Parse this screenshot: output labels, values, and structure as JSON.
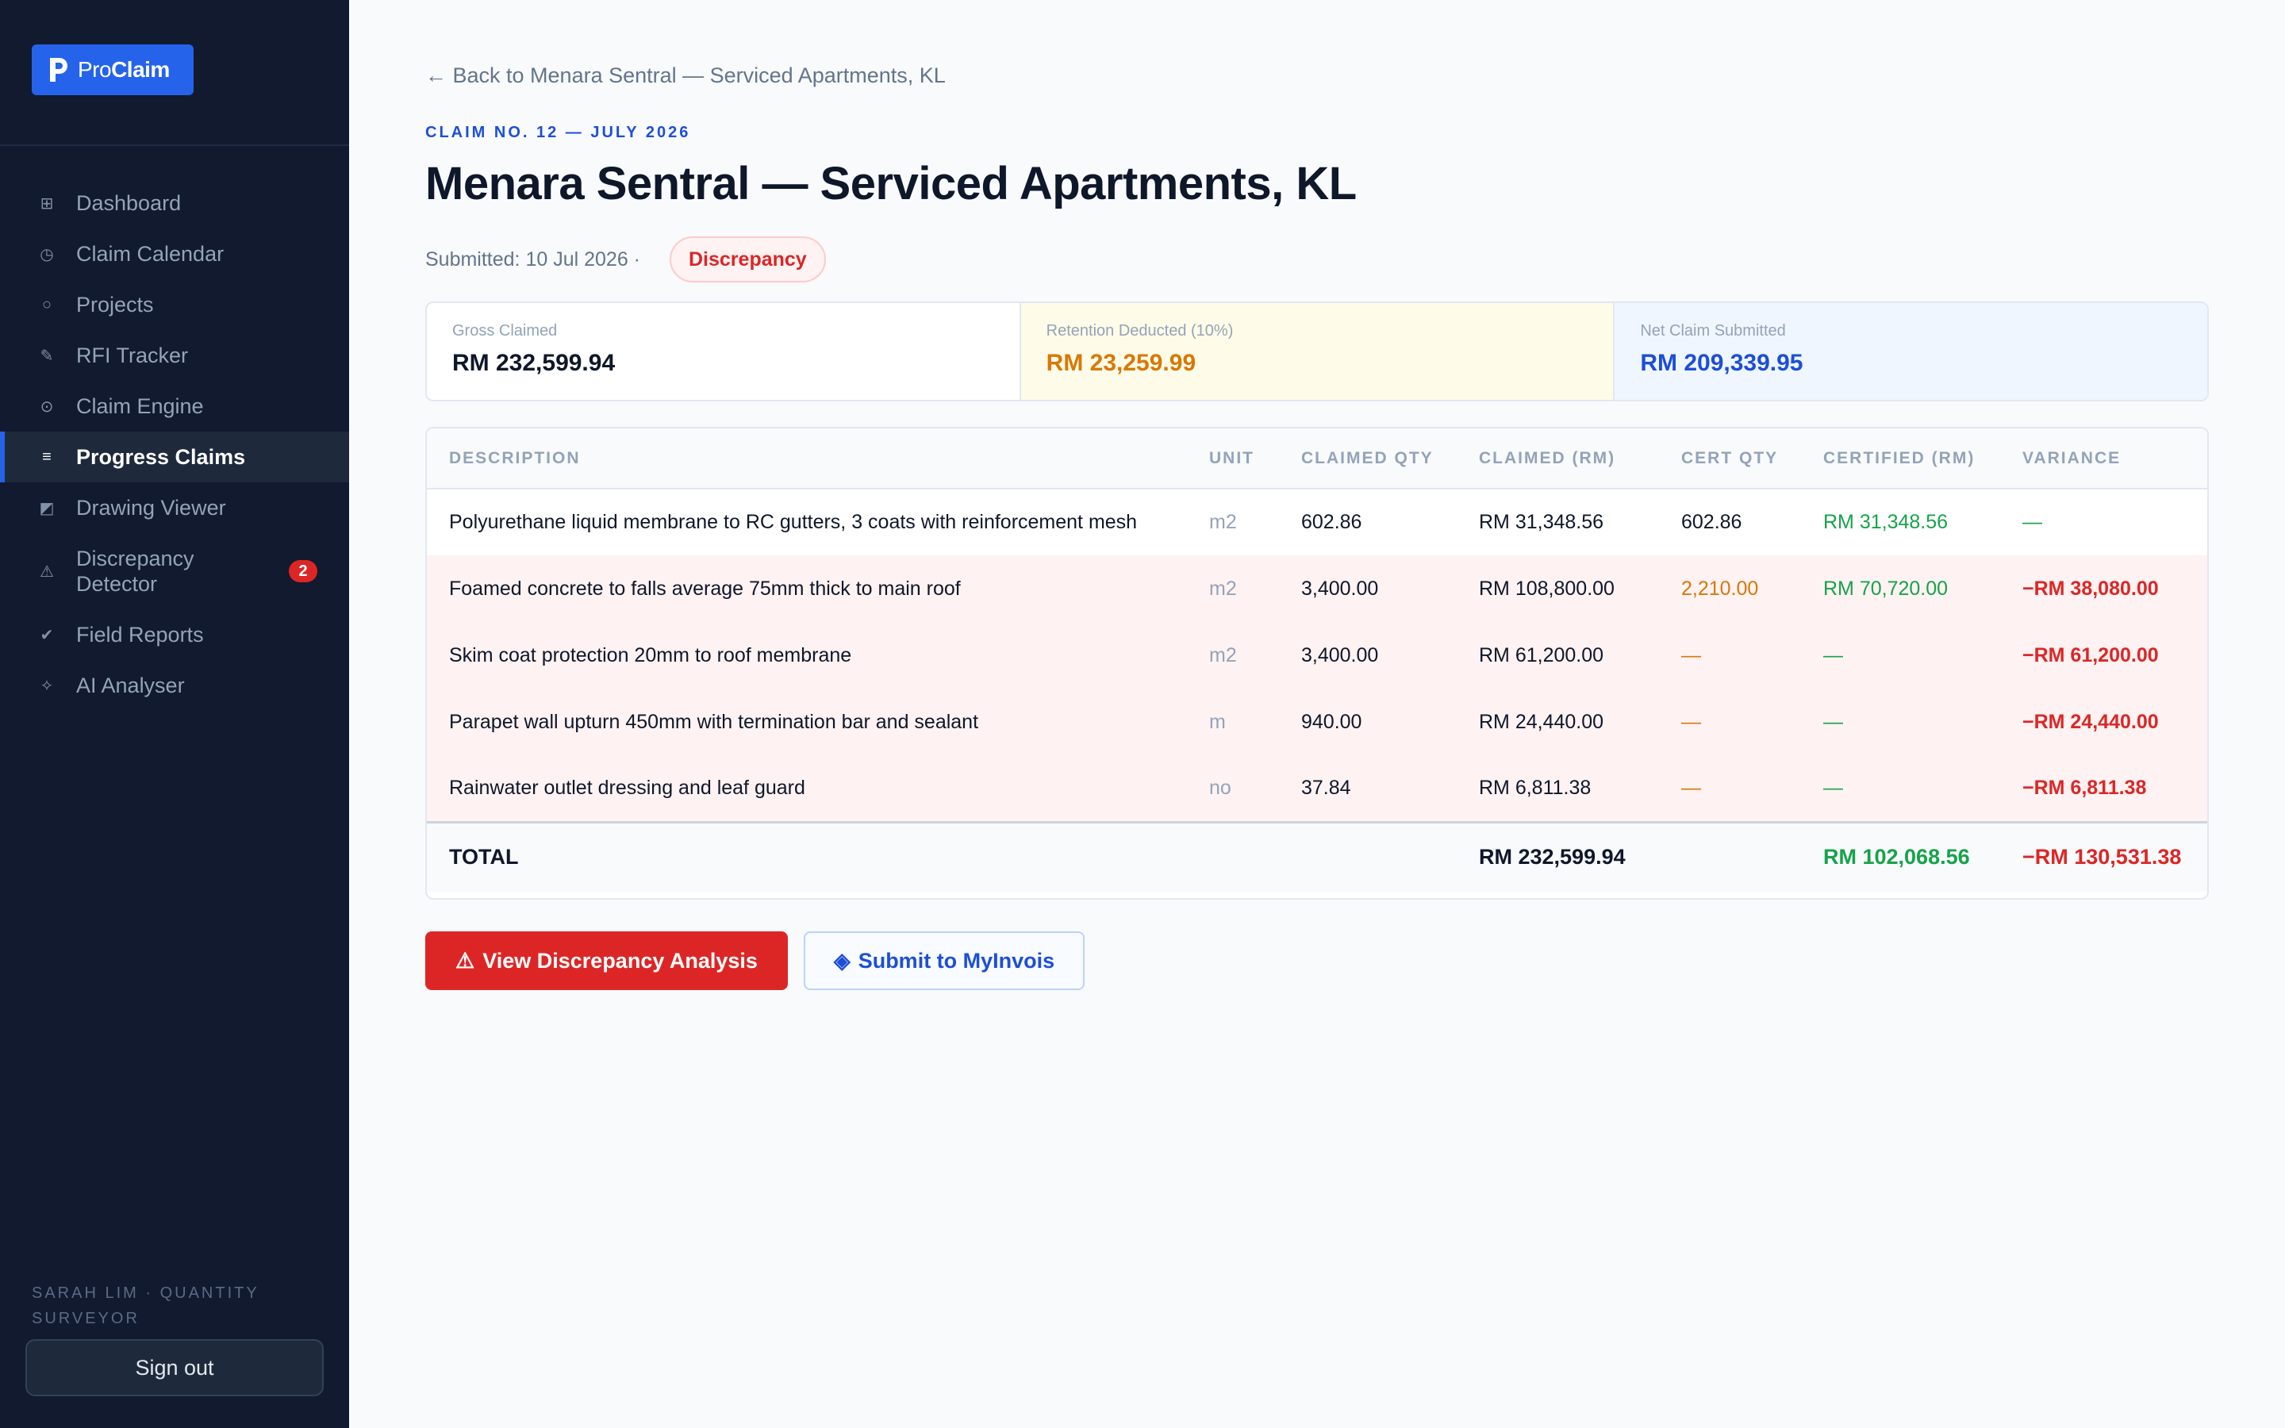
{
  "sidebar": {
    "brand": {
      "pro": "Pro",
      "claim": "Claim"
    },
    "items": [
      {
        "label": "Dashboard",
        "icon": "grid-icon",
        "glyph": "⊞"
      },
      {
        "label": "Claim Calendar",
        "icon": "clock-icon",
        "glyph": "◷"
      },
      {
        "label": "Projects",
        "icon": "circle-icon",
        "glyph": "○"
      },
      {
        "label": "RFI Tracker",
        "icon": "pencil-icon",
        "glyph": "✎"
      },
      {
        "label": "Claim Engine",
        "icon": "target-icon",
        "glyph": "⊙"
      },
      {
        "label": "Progress Claims",
        "icon": "list-icon",
        "glyph": "≡"
      },
      {
        "label": "Drawing Viewer",
        "icon": "drawing-icon",
        "glyph": "◩"
      },
      {
        "label": "Discrepancy Detector",
        "icon": "warning-icon",
        "glyph": "⚠",
        "badge": "2"
      },
      {
        "label": "Field Reports",
        "icon": "check-icon",
        "glyph": "✔"
      },
      {
        "label": "AI Analyser",
        "icon": "sparkle-icon",
        "glyph": "✧"
      }
    ],
    "active_index": 5,
    "user": "SARAH LIM · QUANTITY SURVEYOR",
    "signout_label": "Sign out"
  },
  "header": {
    "back_label": "← Back to Menara Sentral — Serviced Apartments, KL",
    "eyebrow": "CLAIM NO. 12 — JULY 2026",
    "title": "Menara Sentral — Serviced Apartments, KL",
    "submitted": "Submitted: 10 Jul 2026 ·",
    "status": "Discrepancy"
  },
  "summary": {
    "gross": {
      "label": "Gross Claimed",
      "value": "RM 232,599.94"
    },
    "retention": {
      "label": "Retention Deducted (10%)",
      "value": "RM 23,259.99"
    },
    "net": {
      "label": "Net Claim Submitted",
      "value": "RM 209,339.95"
    }
  },
  "table": {
    "columns": [
      "DESCRIPTION",
      "UNIT",
      "CLAIMED QTY",
      "CLAIMED (RM)",
      "CERT QTY",
      "CERTIFIED (RM)",
      "VARIANCE"
    ],
    "rows": [
      {
        "description": "Polyurethane liquid membrane to RC gutters, 3 coats with reinforcement mesh",
        "unit": "m2",
        "claimed_qty": "602.86",
        "claimed_rm": "RM 31,348.56",
        "cert_qty": "602.86",
        "certified_rm": "RM 31,348.56",
        "variance": "—",
        "flag": false
      },
      {
        "description": "Foamed concrete to falls average 75mm thick to main roof",
        "unit": "m2",
        "claimed_qty": "3,400.00",
        "claimed_rm": "RM 108,800.00",
        "cert_qty": "2,210.00",
        "certified_rm": "RM 70,720.00",
        "variance": "−RM 38,080.00",
        "flag": true
      },
      {
        "description": "Skim coat protection 20mm to roof membrane",
        "unit": "m2",
        "claimed_qty": "3,400.00",
        "claimed_rm": "RM 61,200.00",
        "cert_qty": "—",
        "certified_rm": "—",
        "variance": "−RM 61,200.00",
        "flag": true
      },
      {
        "description": "Parapet wall upturn 450mm with termination bar and sealant",
        "unit": "m",
        "claimed_qty": "940.00",
        "claimed_rm": "RM 24,440.00",
        "cert_qty": "—",
        "certified_rm": "—",
        "variance": "−RM 24,440.00",
        "flag": true
      },
      {
        "description": "Rainwater outlet dressing and leaf guard",
        "unit": "no",
        "claimed_qty": "37.84",
        "claimed_rm": "RM 6,811.38",
        "cert_qty": "—",
        "certified_rm": "—",
        "variance": "−RM 6,811.38",
        "flag": true
      }
    ],
    "total": {
      "label": "TOTAL",
      "claimed_rm": "RM 232,599.94",
      "certified_rm": "RM 102,068.56",
      "variance": "−RM 130,531.38"
    }
  },
  "actions": {
    "discrepancy_label": "View Discrepancy Analysis",
    "discrepancy_icon": "⚠",
    "submit_label": "Submit to MyInvois",
    "submit_icon": "◈"
  },
  "colors": {
    "accent": "#2563eb",
    "danger": "#dc2626",
    "success": "#16a34a",
    "warning": "#d97706",
    "sidebar": "#111a2e"
  }
}
